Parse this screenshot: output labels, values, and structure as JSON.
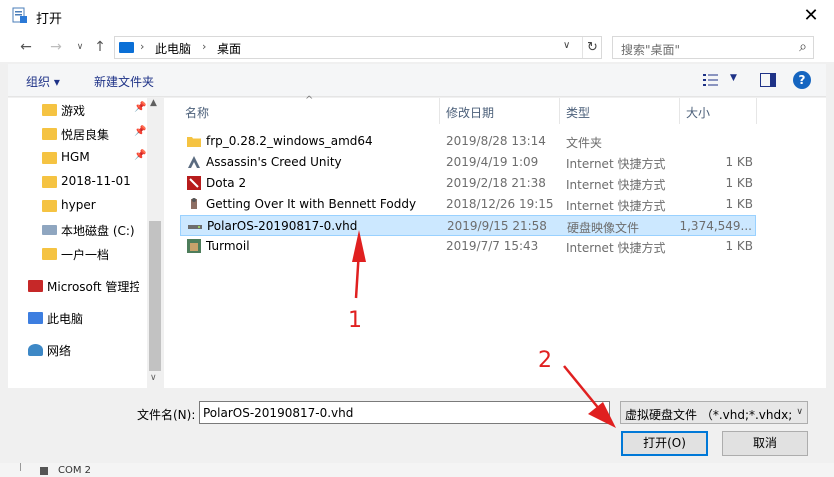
{
  "window": {
    "title": "打开",
    "close_glyph": "✕"
  },
  "nav": {
    "back": "←",
    "forward": "→",
    "recent": "∨",
    "up": "↑",
    "breadcrumb": [
      "此电脑",
      "桌面"
    ],
    "crumb_sep": "›",
    "address_dropdown": "∨",
    "refresh": "↻",
    "search_placeholder": "搜索\"桌面\"",
    "search_glyph": "⌕"
  },
  "toolbar": {
    "organize": "组织 ▾",
    "new_folder": "新建文件夹",
    "view_dropdown": "▼",
    "help": "?"
  },
  "sidebar": {
    "items": [
      {
        "label": "游戏",
        "icon": "folder-icon",
        "pinned": true
      },
      {
        "label": "悦居良集",
        "icon": "folder-icon",
        "pinned": true
      },
      {
        "label": "HGM",
        "icon": "folder-icon",
        "pinned": true
      },
      {
        "label": "2018-11-01",
        "icon": "folder-icon",
        "pinned": false
      },
      {
        "label": "hyper",
        "icon": "folder-icon",
        "pinned": false
      },
      {
        "label": "本地磁盘 (C:)",
        "icon": "drive-icon",
        "pinned": false
      },
      {
        "label": "一户一档",
        "icon": "folder-icon",
        "pinned": false
      },
      {
        "label": "Microsoft 管理控",
        "icon": "management-console-icon",
        "pinned": false
      },
      {
        "label": "此电脑",
        "icon": "this-pc-icon",
        "pinned": false
      },
      {
        "label": "网络",
        "icon": "network-icon",
        "pinned": false
      }
    ],
    "pin_glyph": "📌",
    "scroll_up": "▲",
    "scroll_down": "∨"
  },
  "columns": {
    "name": "名称",
    "date": "修改日期",
    "type": "类型",
    "size": "大小",
    "sort_glyph": "^"
  },
  "files": [
    {
      "name": "frp_0.28.2_windows_amd64",
      "date": "2019/8/28 13:14",
      "type": "文件夹",
      "size": "",
      "icon": "folder-icon",
      "selected": false
    },
    {
      "name": "Assassin's Creed Unity",
      "date": "2019/4/19 1:09",
      "type": "Internet 快捷方式",
      "size": "1 KB",
      "icon": "shortcut-icon",
      "selected": false
    },
    {
      "name": "Dota 2",
      "date": "2019/2/18 21:38",
      "type": "Internet 快捷方式",
      "size": "1 KB",
      "icon": "shortcut-icon",
      "selected": false
    },
    {
      "name": "Getting Over It with Bennett Foddy",
      "date": "2018/12/26 19:15",
      "type": "Internet 快捷方式",
      "size": "1 KB",
      "icon": "shortcut-icon",
      "selected": false
    },
    {
      "name": "PolarOS-20190817-0.vhd",
      "date": "2019/9/15 21:58",
      "type": "硬盘映像文件",
      "size": "1,374,549...",
      "icon": "vhd-icon",
      "selected": true
    },
    {
      "name": "Turmoil",
      "date": "2019/7/7 15:43",
      "type": "Internet 快捷方式",
      "size": "1 KB",
      "icon": "shortcut-icon",
      "selected": false
    }
  ],
  "footer": {
    "filename_label": "文件名(N):",
    "filename_value": "PolarOS-20190817-0.vhd",
    "filter_value": "虚拟硬盘文件 （*.vhd;*.vhdx;*",
    "filter_dropdown": "∨",
    "open_label": "打开(O)",
    "cancel_label": "取消"
  },
  "background_strip": {
    "label": "COM 2"
  },
  "annotations": {
    "arrow1_label": "1",
    "arrow2_label": "2",
    "color": "#e02020"
  }
}
